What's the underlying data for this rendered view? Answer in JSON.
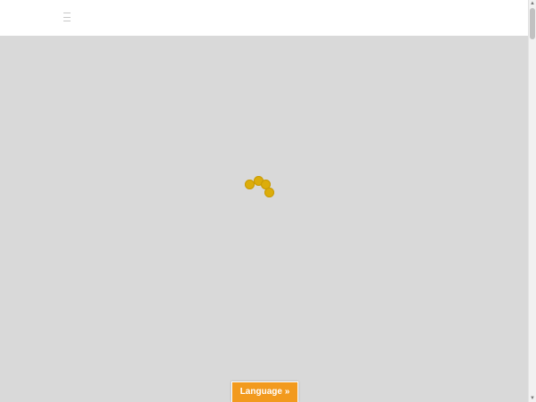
{
  "header": {
    "menu_icon": "hamburger-menu-icon"
  },
  "loader": {
    "icon": "loading-dots-icon",
    "color": "#dcad0b"
  },
  "language_button": {
    "label": "Language »",
    "background": "#f29a1e",
    "text_color": "#ffffff"
  },
  "overlay": {
    "color": "#d6d6d6"
  },
  "scrollbar": {
    "up_arrow_icon": "scroll-up-arrow-icon",
    "up_arrow_glyph": "▲",
    "down_arrow_icon": "scroll-down-arrow-icon",
    "down_arrow_glyph": "▼"
  }
}
